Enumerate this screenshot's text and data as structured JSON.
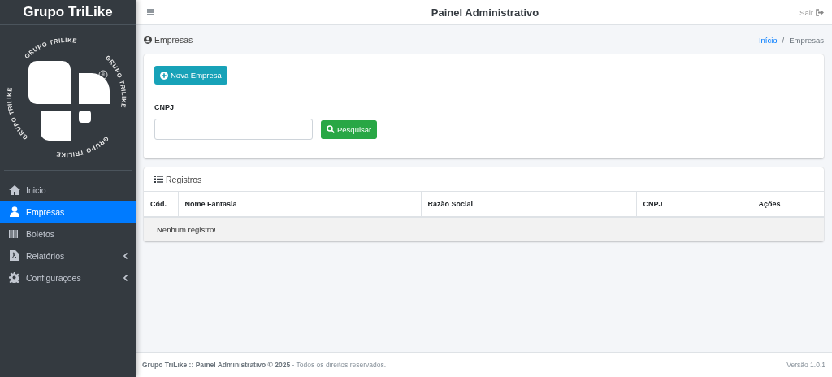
{
  "sidebar": {
    "brand": "Grupo TriLike",
    "logo": {
      "ring_texts": [
        "GRUPO TRILIKE",
        "GRUPO TRILIKE",
        "GRUPO TRILIKE",
        "GRUPO TRILIKE"
      ],
      "registered_mark": "®"
    },
    "items": [
      {
        "label": "Inicio",
        "selected": false,
        "has_submenu": false
      },
      {
        "label": "Empresas",
        "selected": true,
        "has_submenu": false
      },
      {
        "label": "Boletos",
        "selected": false,
        "has_submenu": false
      },
      {
        "label": "Relatórios",
        "selected": false,
        "has_submenu": true
      },
      {
        "label": "Configurações",
        "selected": false,
        "has_submenu": true
      }
    ]
  },
  "header": {
    "title": "Painel Administrativo",
    "logout": "Sair"
  },
  "page": {
    "title": "Empresas",
    "breadcrumb_separator": "/",
    "breadcrumb": [
      {
        "label": "Início",
        "link": true
      },
      {
        "label": "Empresas",
        "link": false
      }
    ]
  },
  "search_card": {
    "new_button": "Nova Empresa",
    "field_label": "CNPJ",
    "search_button": "Pesquisar"
  },
  "results_card": {
    "title": "Registros",
    "columns": [
      "Cód.",
      "Nome Fantasia",
      "Razão Social",
      "CNPJ",
      "Ações"
    ],
    "empty_message": "Nenhum registro!"
  },
  "footer": {
    "copyright": "**Grupo TriLike :: Painel Administrativo © 2025** - Todos os direitos reservados.",
    "version": "Versão 1.0.1"
  }
}
